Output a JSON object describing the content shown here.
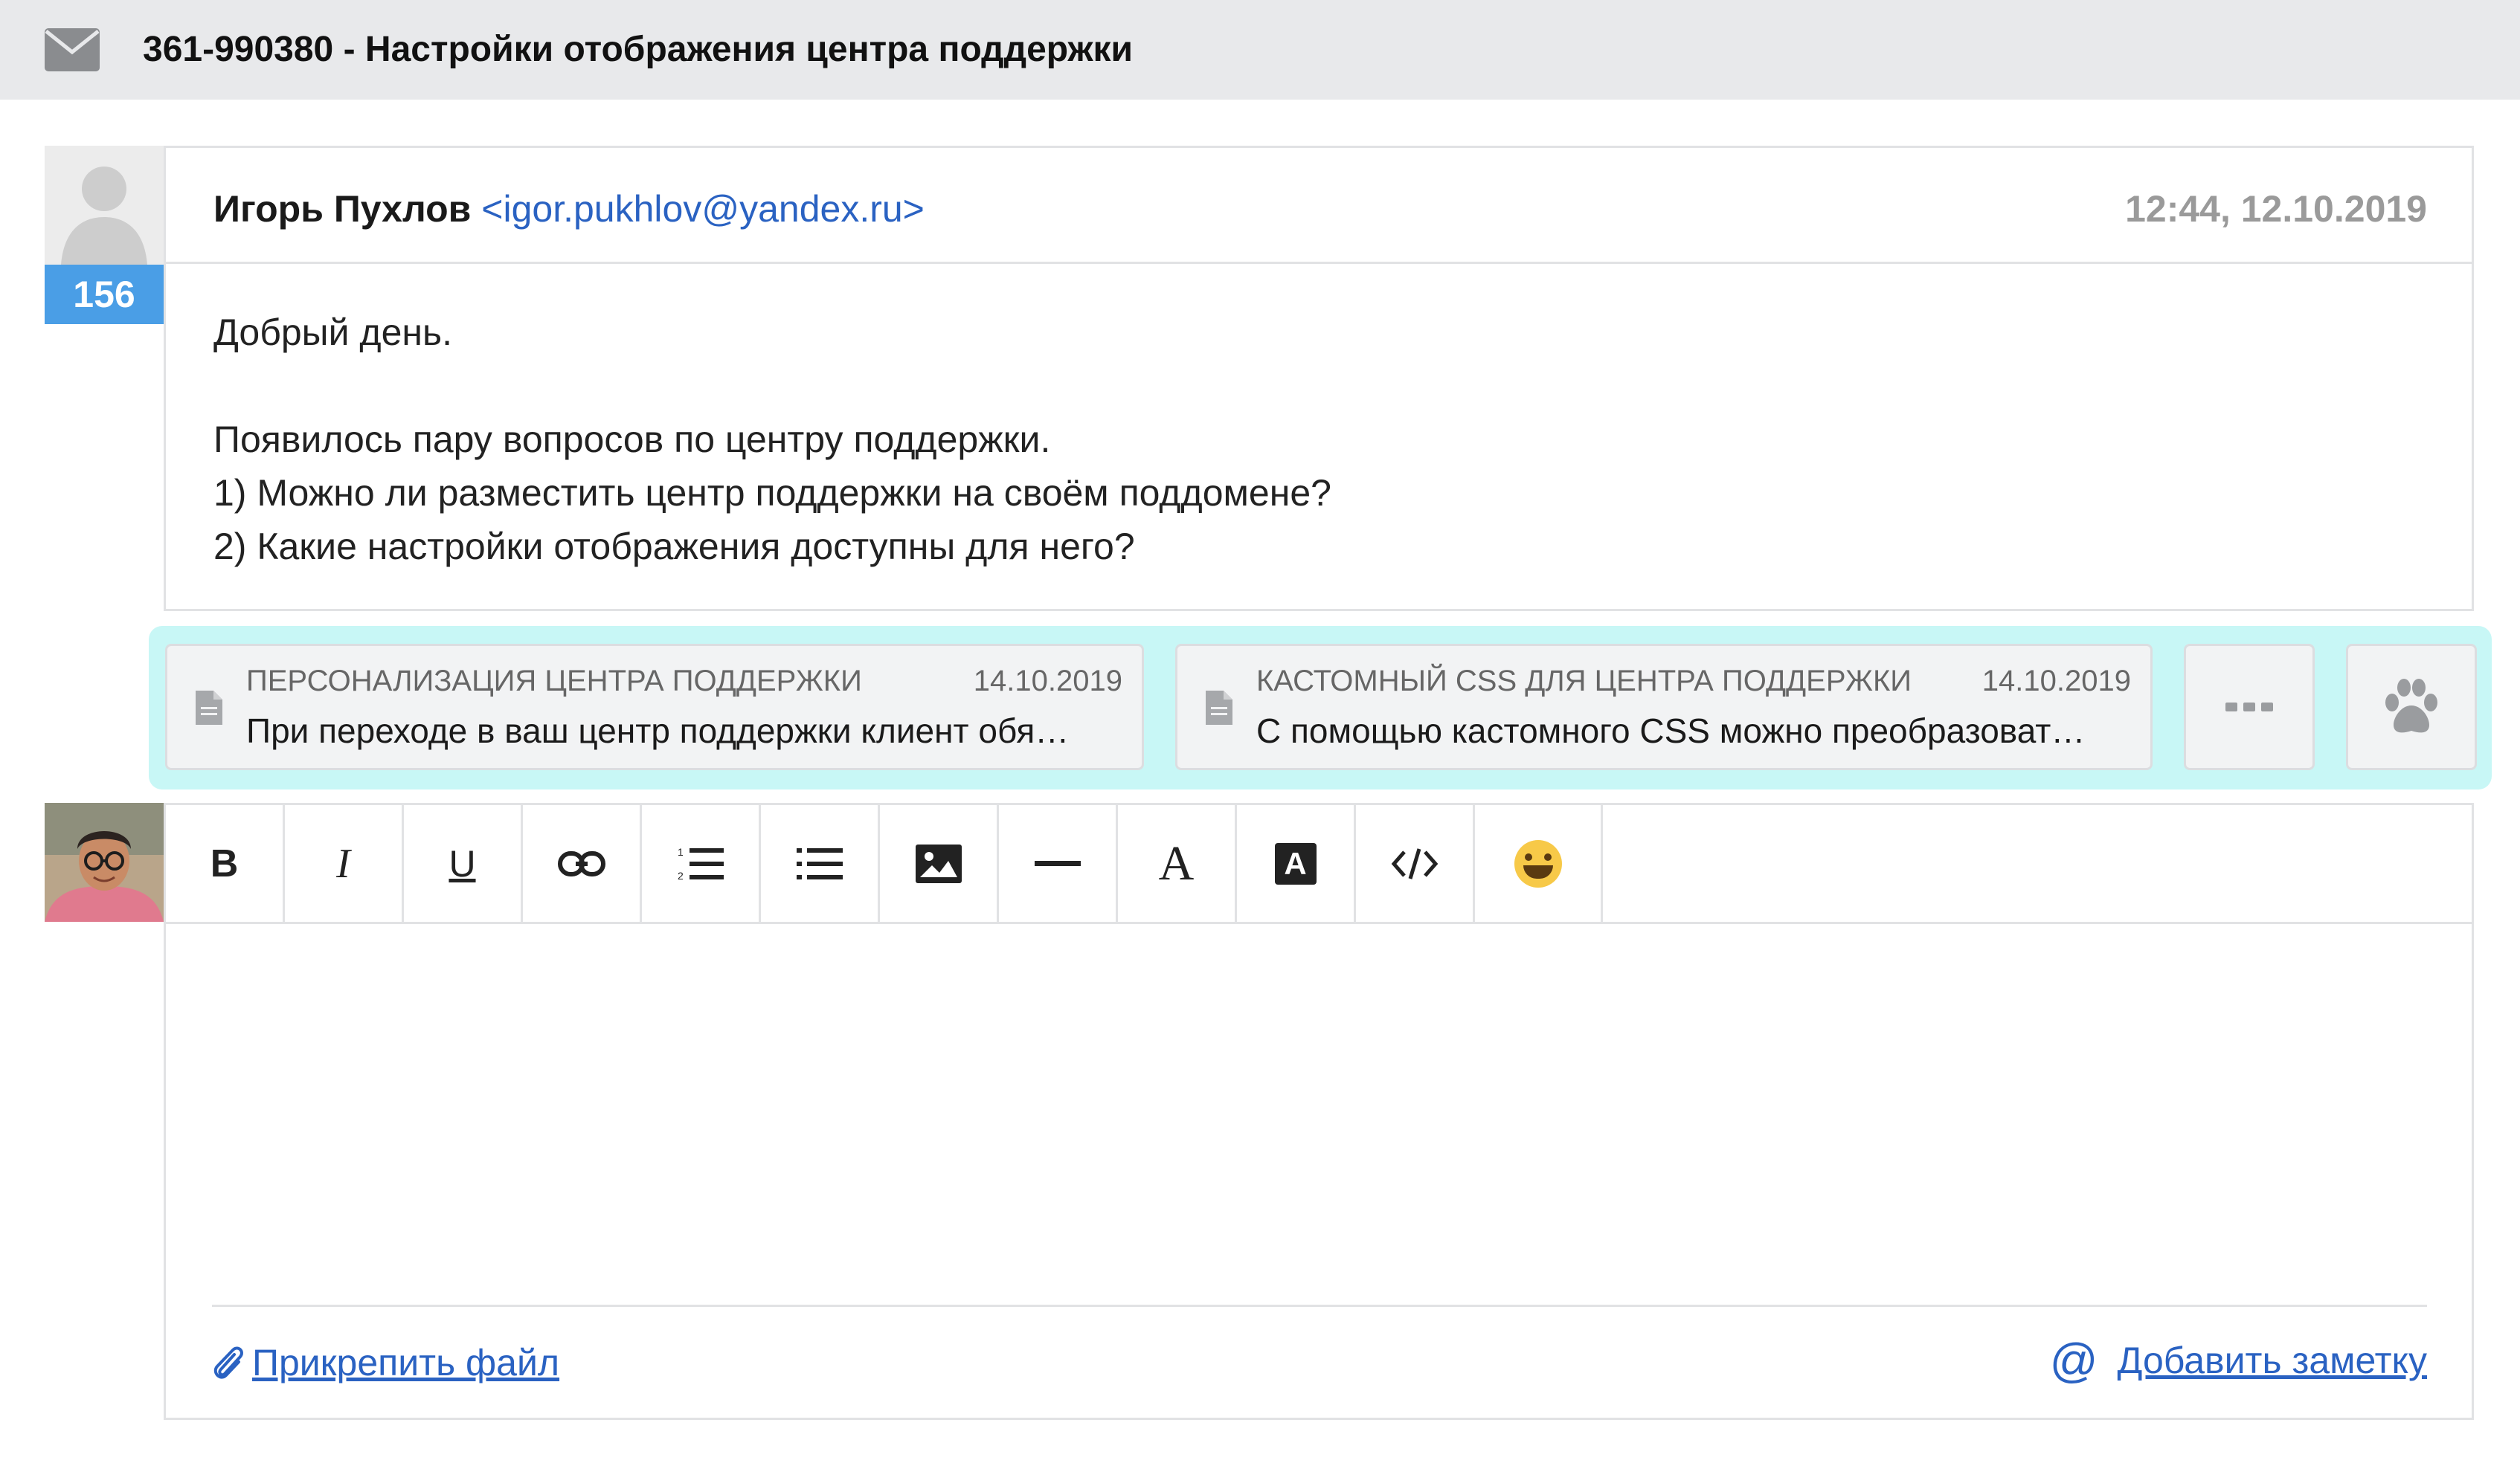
{
  "header": {
    "title": "361-990380 - Настройки отображения центра поддержки"
  },
  "message": {
    "badge": "156",
    "sender_name": "Игорь Пухлов",
    "sender_email": "<igor.pukhlov@yandex.ru>",
    "time": "12:44, 12.10.2019",
    "body": [
      "Добрый день.",
      "",
      "Появилось пару вопросов по центру поддержки.",
      "1) Можно ли разместить центр поддержки на своём поддомене?",
      "2) Какие настройки отображения доступны для него?"
    ]
  },
  "kb_suggestions": [
    {
      "title": "ПЕРСОНАЛИЗАЦИЯ ЦЕНТРА ПОДДЕРЖКИ",
      "date": "14.10.2019",
      "snippet": "При переходе в ваш центр поддержки клиент обя…"
    },
    {
      "title": "КАСТОМНЫЙ CSS ДЛЯ ЦЕНТРА ПОДДЕРЖКИ",
      "date": "14.10.2019",
      "snippet": "С помощью кастомного CSS можно преобразоват…"
    }
  ],
  "toolbar": {
    "bold_label": "B",
    "italic_label": "I",
    "underline_label": "U",
    "font_label": "A",
    "font_bg_label": "A",
    "emoji": "😄"
  },
  "footer": {
    "attach_label": "Прикрепить файл",
    "note_label": "Добавить заметку",
    "note_symbol": "@"
  },
  "colors": {
    "header_bg": "#e8e9eb",
    "badge_bg": "#4a9ee6",
    "link": "#2a62c2",
    "kb_strip_bg": "#c8f7f6"
  }
}
